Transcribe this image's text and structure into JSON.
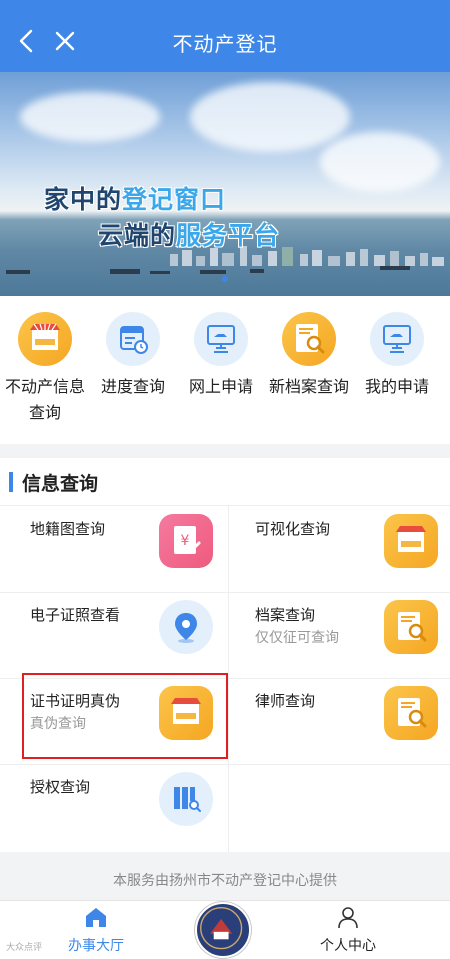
{
  "header": {
    "title": "不动产登记",
    "back_icon": "chevron-left-icon",
    "close_icon": "close-icon"
  },
  "banner": {
    "slogan_line1_pre": "家中的",
    "slogan_line1_hl": "登记窗口",
    "slogan_line2_pre": "云端的",
    "slogan_line2_hl": "服务平台"
  },
  "quick_menu": [
    {
      "label": "不动产信息查询",
      "icon": "storefront-icon",
      "color": "orange"
    },
    {
      "label": "进度查询",
      "icon": "calendar-icon",
      "color": "blue"
    },
    {
      "label": "网上申请",
      "icon": "monitor-hand-icon",
      "color": "blue"
    },
    {
      "label": "新档案查询",
      "icon": "ems-search-icon",
      "color": "orange"
    },
    {
      "label": "我的申请",
      "icon": "monitor-hand-icon",
      "color": "blue"
    }
  ],
  "section": {
    "title": "信息查询"
  },
  "grid": [
    {
      "title": "地籍图查询",
      "sub": "",
      "icon": "yuan-document-icon"
    },
    {
      "title": "可视化查询",
      "sub": "",
      "icon": "storefront-icon"
    },
    {
      "title": "电子证照查看",
      "sub": "",
      "icon": "location-pin-icon"
    },
    {
      "title": "档案查询",
      "sub": "仅仅征可查询",
      "icon": "ems-search-icon"
    },
    {
      "title": "证书证明真伪",
      "sub": "真伪查询",
      "icon": "storefront-icon"
    },
    {
      "title": "律师查询",
      "sub": "",
      "icon": "ems-search-icon"
    },
    {
      "title": "授权查询",
      "sub": "",
      "icon": "book-search-icon"
    }
  ],
  "footer": {
    "provider_text": "本服务由扬州市不动产登记中心提供"
  },
  "tabbar": {
    "home_label": "办事大厅",
    "profile_label": "个人中心",
    "watermark": "大众点评"
  },
  "colors": {
    "primary": "#3e87e8",
    "orange": "#f5a623",
    "highlight_border": "#e02020"
  }
}
